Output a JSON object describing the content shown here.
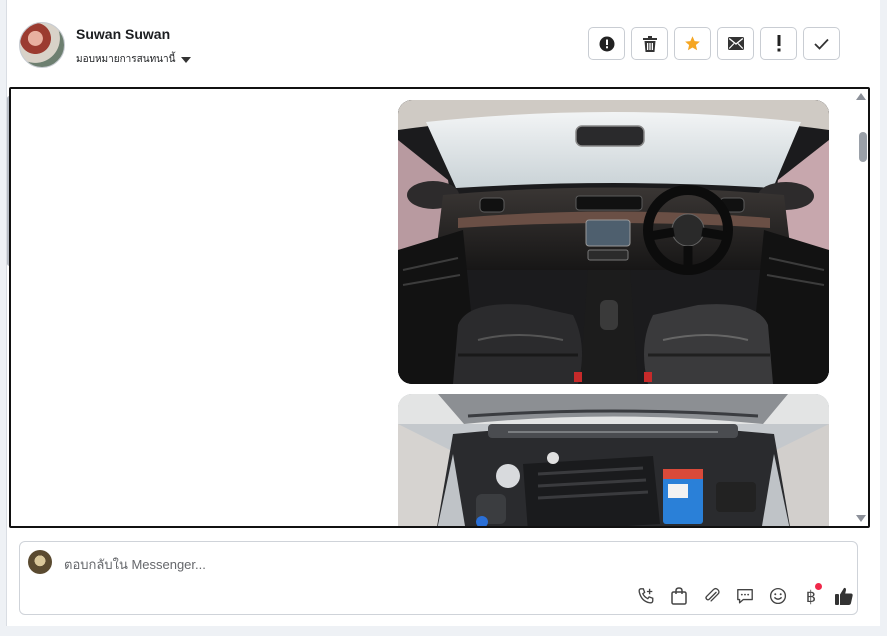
{
  "contact": {
    "name": "Suwan Suwan",
    "assign_label": "มอบหมายการสนทนานี้"
  },
  "toolbar": {
    "actions": [
      {
        "name": "report-spam",
        "icon": "alert-circle-icon"
      },
      {
        "name": "delete",
        "icon": "trash-icon"
      },
      {
        "name": "star",
        "icon": "star-icon",
        "color": "#f5a623"
      },
      {
        "name": "mark-unread",
        "icon": "envelope-icon"
      },
      {
        "name": "mark-important",
        "icon": "exclamation-icon"
      },
      {
        "name": "mark-done",
        "icon": "check-icon"
      }
    ]
  },
  "messages": [
    {
      "type": "image",
      "subject": "car-interior-dashboard"
    },
    {
      "type": "image",
      "subject": "car-engine-bay"
    }
  ],
  "composer": {
    "placeholder": "ตอบกลับใน Messenger...",
    "tools": [
      "call-add-icon",
      "shopping-bag-icon",
      "paperclip-icon",
      "speech-bubble-icon",
      "emoji-icon",
      "baht-payment-icon",
      "thumbs-up-icon"
    ],
    "baht_symbol": "฿"
  },
  "colors": {
    "star": "#f5a623",
    "notification_dot": "#f0284a"
  }
}
